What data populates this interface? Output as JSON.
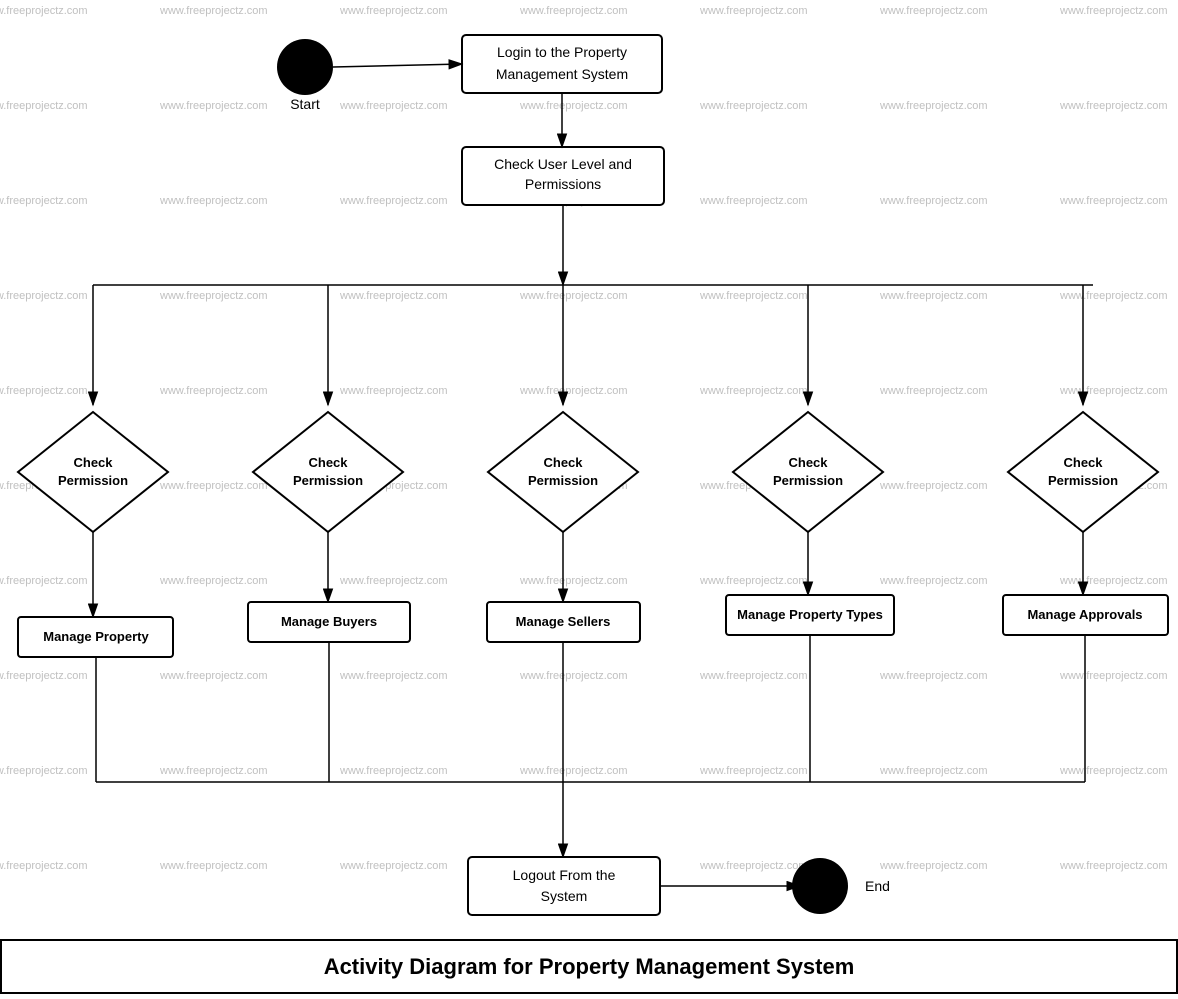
{
  "watermarks": {
    "text": "www.freeprojectz.com",
    "rows": 10,
    "cols": 8
  },
  "diagram": {
    "title": "Activity Diagram for Property Management System",
    "nodes": {
      "start": {
        "label": "Start"
      },
      "login": {
        "label": "Login to the Property\nManagement System"
      },
      "check_user": {
        "label": "Check User Level and\nPermissions"
      },
      "check_perm1": {
        "label": "Check\nPermission"
      },
      "check_perm2": {
        "label": "Check\nPermission"
      },
      "check_perm3": {
        "label": "Check\nPermission"
      },
      "check_perm4": {
        "label": "Check\nPermission"
      },
      "check_perm5": {
        "label": "Check\nPermission"
      },
      "manage_property": {
        "label": "Manage Property"
      },
      "manage_buyers": {
        "label": "Manage Buyers"
      },
      "manage_sellers": {
        "label": "Manage Sellers"
      },
      "manage_property_types": {
        "label": "Manage Property Types"
      },
      "manage_approvals": {
        "label": "Manage Approvals"
      },
      "logout": {
        "label": "Logout From the\nSystem"
      },
      "end": {
        "label": "End"
      }
    }
  }
}
